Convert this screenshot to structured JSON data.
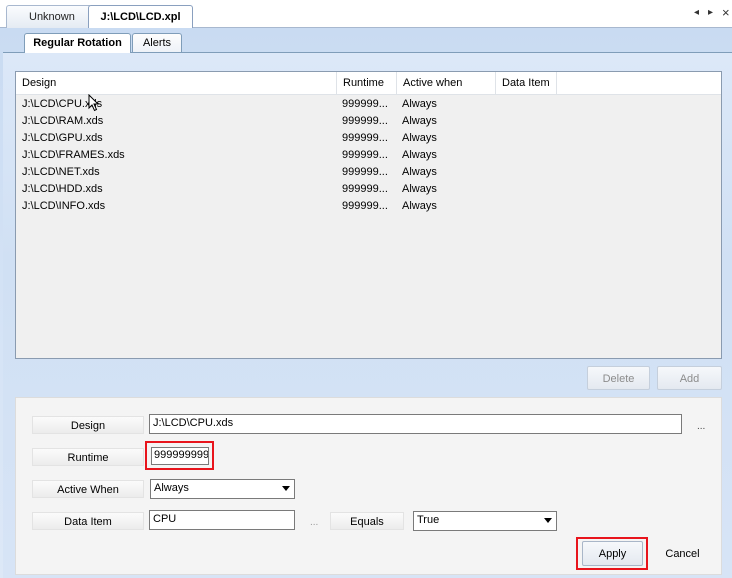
{
  "doc_tabs": [
    {
      "label": "Unknown"
    },
    {
      "label": "J:\\LCD\\LCD.xpl"
    }
  ],
  "strip_controls": {
    "prev": "◂",
    "next": "▸",
    "close": "×"
  },
  "inner_tabs": [
    {
      "label": "Regular Rotation"
    },
    {
      "label": "Alerts"
    }
  ],
  "list": {
    "columns": [
      "Design",
      "Runtime",
      "Active when",
      "Data Item"
    ],
    "rows": [
      {
        "design": "J:\\LCD\\CPU.xds",
        "runtime": "999999...",
        "active": "Always",
        "data_item": ""
      },
      {
        "design": "J:\\LCD\\RAM.xds",
        "runtime": "999999...",
        "active": "Always",
        "data_item": ""
      },
      {
        "design": "J:\\LCD\\GPU.xds",
        "runtime": "999999...",
        "active": "Always",
        "data_item": ""
      },
      {
        "design": "J:\\LCD\\FRAMES.xds",
        "runtime": "999999...",
        "active": "Always",
        "data_item": ""
      },
      {
        "design": "J:\\LCD\\NET.xds",
        "runtime": "999999...",
        "active": "Always",
        "data_item": ""
      },
      {
        "design": "J:\\LCD\\HDD.xds",
        "runtime": "999999...",
        "active": "Always",
        "data_item": ""
      },
      {
        "design": "J:\\LCD\\INFO.xds",
        "runtime": "999999...",
        "active": "Always",
        "data_item": ""
      }
    ]
  },
  "list_buttons": {
    "delete": "Delete",
    "add": "Add"
  },
  "form": {
    "design_label": "Design",
    "design_value": "J:\\LCD\\CPU.xds",
    "browse": "...",
    "runtime_label": "Runtime",
    "runtime_value": "999999999",
    "active_when_label": "Active When",
    "active_when_value": "Always",
    "data_item_label": "Data Item",
    "data_item_value": "CPU",
    "data_item_browse": "...",
    "equals_label": "Equals",
    "equals_value": "True"
  },
  "action_buttons": {
    "apply": "Apply",
    "cancel": "Cancel"
  },
  "colors": {
    "highlight": "#e8141c",
    "panel": "#d6e4f6"
  }
}
